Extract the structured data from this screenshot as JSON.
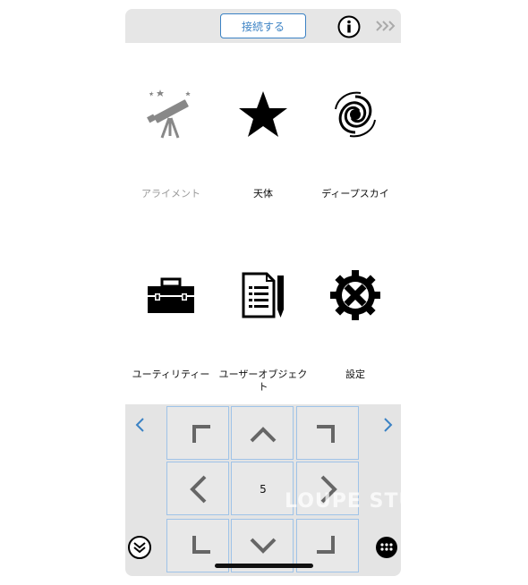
{
  "topbar": {
    "connect_label": "接続する",
    "info_icon": "info-circle-icon",
    "more_icon": "triple-chevron-right-icon"
  },
  "tiles": [
    {
      "label": "アライメント",
      "icon": "telescope-icon",
      "disabled": true
    },
    {
      "label": "天体",
      "icon": "star-icon",
      "disabled": false
    },
    {
      "label": "ディープスカイ",
      "icon": "galaxy-icon",
      "disabled": false
    },
    {
      "label": "ユーティリティー",
      "icon": "toolbox-icon",
      "disabled": false
    },
    {
      "label": "ユーザーオブジェクト",
      "icon": "document-pen-icon",
      "disabled": false
    },
    {
      "label": "設定",
      "icon": "gear-icon",
      "disabled": false
    }
  ],
  "pad": {
    "speed_value": "5",
    "left_arrow": "chevron-left-icon",
    "right_arrow": "chevron-right-icon",
    "collapse_icon": "double-chevron-down-icon",
    "keypad_icon": "keypad-icon"
  },
  "watermark": "LOUPE STUDIO",
  "colors": {
    "accent": "#3b82c4",
    "key_border": "#9fc3e8",
    "pad_bg": "#e4e4e4"
  }
}
